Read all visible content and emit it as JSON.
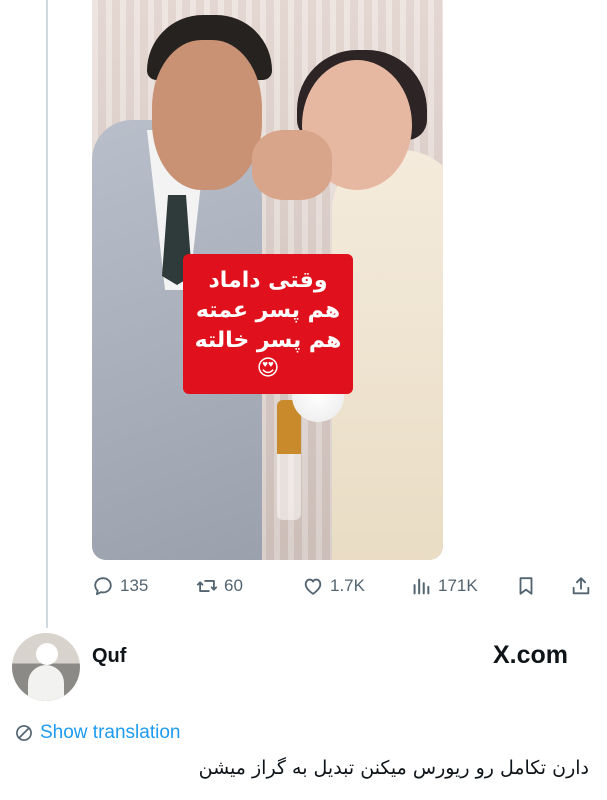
{
  "media": {
    "overlay_lines": [
      "وقتی داماد",
      "هم پسر عمته",
      "هم پسر خالته"
    ],
    "overlay_emoji": "😍"
  },
  "actions": {
    "replies": "135",
    "reposts": "60",
    "likes": "1.7K",
    "views": "171K"
  },
  "reply": {
    "username": "Quf",
    "brand": "X.com",
    "show_translation": "Show translation",
    "text": "دارن تکامل رو ریورس میکنن تبدیل به گراز میشن"
  },
  "colors": {
    "accent": "#1d9bf0",
    "overlay_bg": "#e0111c",
    "icon_gray": "#536471",
    "thread_line": "#cfd9de"
  },
  "icons": [
    "reply-icon",
    "repost-icon",
    "like-icon",
    "views-icon",
    "bookmark-icon",
    "share-icon",
    "globe-icon"
  ]
}
